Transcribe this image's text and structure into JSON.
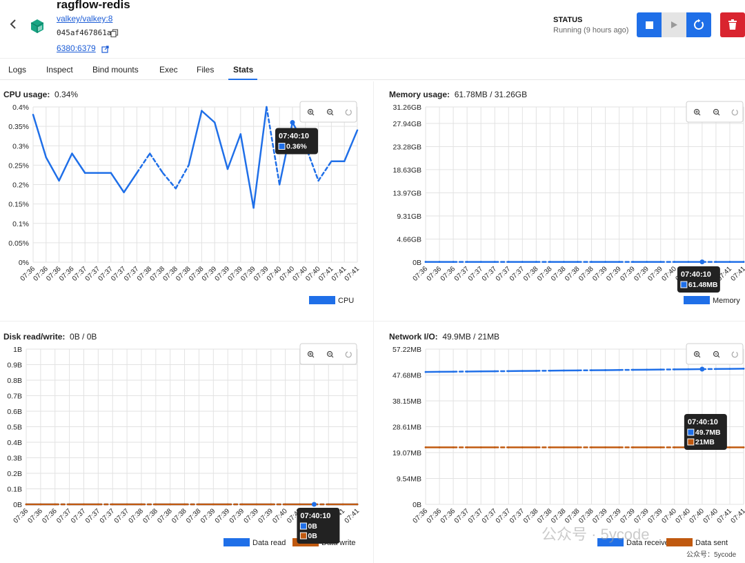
{
  "container": {
    "name": "ragflow-redis",
    "image": "valkey/valkey:8",
    "id": "045af467861a",
    "ports": "6380:6379",
    "status_label": "STATUS",
    "status_value": "Running (9 hours ago)"
  },
  "tabs": [
    "Logs",
    "Inspect",
    "Bind mounts",
    "Exec",
    "Files",
    "Stats"
  ],
  "active_tab": "Stats",
  "colors": {
    "primary": "#1f6fe8",
    "danger": "#d9242f",
    "sent": "#c0590f"
  },
  "icons": {
    "back": "chevron-left-icon",
    "container": "cube-icon",
    "copy": "copy-icon",
    "external": "external-link-icon",
    "stop": "stop-icon",
    "play": "play-icon",
    "restart": "restart-icon",
    "delete": "trash-icon",
    "zoom_in": "zoom-in-icon",
    "zoom_out": "zoom-out-icon",
    "reset": "reset-icon"
  },
  "charts": {
    "cpu": {
      "label": "CPU usage:",
      "value": "0.34%"
    },
    "memory": {
      "label": "Memory usage:",
      "value": "61.78MB / 31.26GB"
    },
    "disk": {
      "label": "Disk read/write:",
      "value": "0B / 0B"
    },
    "network": {
      "label": "Network I/O:",
      "value": "49.9MB / 21MB"
    }
  },
  "watermark": {
    "text": "公众号 · 5ycode",
    "caption": "公众号：5ycode"
  },
  "chart_data": [
    {
      "id": "cpu",
      "type": "line",
      "x": [
        "07:36",
        "07:36",
        "07:36",
        "07:36",
        "07:37",
        "07:37",
        "07:37",
        "07:37",
        "07:37",
        "07:38",
        "07:38",
        "07:38",
        "07:38",
        "07:38",
        "07:39",
        "07:39",
        "07:39",
        "07:39",
        "07:39",
        "07:40",
        "07:40",
        "07:40",
        "07:40",
        "07:41",
        "07:41",
        "07:41"
      ],
      "yticks": [
        "0%",
        "0.05%",
        "0.1%",
        "0.15%",
        "0.2%",
        "0.25%",
        "0.3%",
        "0.35%",
        "0.4%"
      ],
      "ylim": [
        0,
        0.4
      ],
      "series": [
        {
          "name": "CPU",
          "color": "#1f6fe8",
          "values": [
            0.38,
            0.27,
            0.21,
            0.28,
            0.23,
            0.23,
            0.23,
            0.18,
            0.23,
            0.28,
            0.23,
            0.19,
            0.25,
            0.39,
            0.36,
            0.24,
            0.33,
            0.14,
            0.4,
            0.2,
            0.36,
            0.3,
            0.21,
            0.26,
            0.26,
            0.34
          ]
        }
      ],
      "tooltip": {
        "time": "07:40:10",
        "items": [
          "0.36%"
        ]
      }
    },
    {
      "id": "memory",
      "type": "line",
      "x": [
        "07:36",
        "07:36",
        "07:36",
        "07:37",
        "07:37",
        "07:37",
        "07:37",
        "07:37",
        "07:38",
        "07:38",
        "07:38",
        "07:38",
        "07:38",
        "07:39",
        "07:39",
        "07:39",
        "07:39",
        "07:39",
        "07:40",
        "07:40",
        "07:40",
        "07:40",
        "07:41",
        "07:41"
      ],
      "yticks": [
        "0B",
        "4.66GB",
        "9.31GB",
        "13.97GB",
        "18.63GB",
        "23.28GB",
        "27.94GB",
        "31.26GB"
      ],
      "ytick_values": [
        0,
        4.66,
        9.31,
        13.97,
        18.63,
        23.28,
        27.94,
        31.26
      ],
      "ylim": [
        0,
        31.26
      ],
      "series": [
        {
          "name": "Memory",
          "color": "#1f6fe8",
          "constant": 0.06
        }
      ],
      "tooltip": {
        "time": "07:40:10",
        "items": [
          "61.48MB"
        ]
      }
    },
    {
      "id": "disk",
      "type": "line",
      "x": [
        "07:36",
        "07:36",
        "07:36",
        "07:37",
        "07:37",
        "07:37",
        "07:37",
        "07:37",
        "07:38",
        "07:38",
        "07:38",
        "07:38",
        "07:38",
        "07:39",
        "07:39",
        "07:39",
        "07:39",
        "07:39",
        "07:40",
        "07:40",
        "07:40",
        "07:40",
        "07:41",
        "07:41"
      ],
      "yticks": [
        "0B",
        "0.1B",
        "0.2B",
        "0.3B",
        "0.4B",
        "0.5B",
        "0.6B",
        "0.7B",
        "0.8B",
        "0.9B",
        "1B"
      ],
      "ylim": [
        0,
        1
      ],
      "series": [
        {
          "name": "Data read",
          "color": "#1f6fe8",
          "constant": 0
        },
        {
          "name": "Data write",
          "color": "#c0590f",
          "constant": 0
        }
      ],
      "tooltip": {
        "time": "07:40:10",
        "items": [
          "0B",
          "0B"
        ]
      }
    },
    {
      "id": "network",
      "type": "line",
      "x": [
        "07:36",
        "07:36",
        "07:36",
        "07:37",
        "07:37",
        "07:37",
        "07:37",
        "07:37",
        "07:38",
        "07:38",
        "07:38",
        "07:38",
        "07:38",
        "07:39",
        "07:39",
        "07:39",
        "07:39",
        "07:39",
        "07:40",
        "07:40",
        "07:40",
        "07:40",
        "07:41",
        "07:41"
      ],
      "yticks": [
        "0B",
        "9.54MB",
        "19.07MB",
        "28.61MB",
        "38.15MB",
        "47.68MB",
        "57.22MB"
      ],
      "ytick_values": [
        0,
        9.54,
        19.07,
        28.61,
        38.15,
        47.68,
        57.22
      ],
      "ylim": [
        0,
        57.22
      ],
      "series": [
        {
          "name": "Data received",
          "color": "#1f6fe8",
          "start": 48.8,
          "end": 50.0
        },
        {
          "name": "Data sent",
          "color": "#c0590f",
          "constant": 21.0
        }
      ],
      "tooltip": {
        "time": "07:40:10",
        "items": [
          "49.7MB",
          "21MB"
        ]
      }
    }
  ]
}
